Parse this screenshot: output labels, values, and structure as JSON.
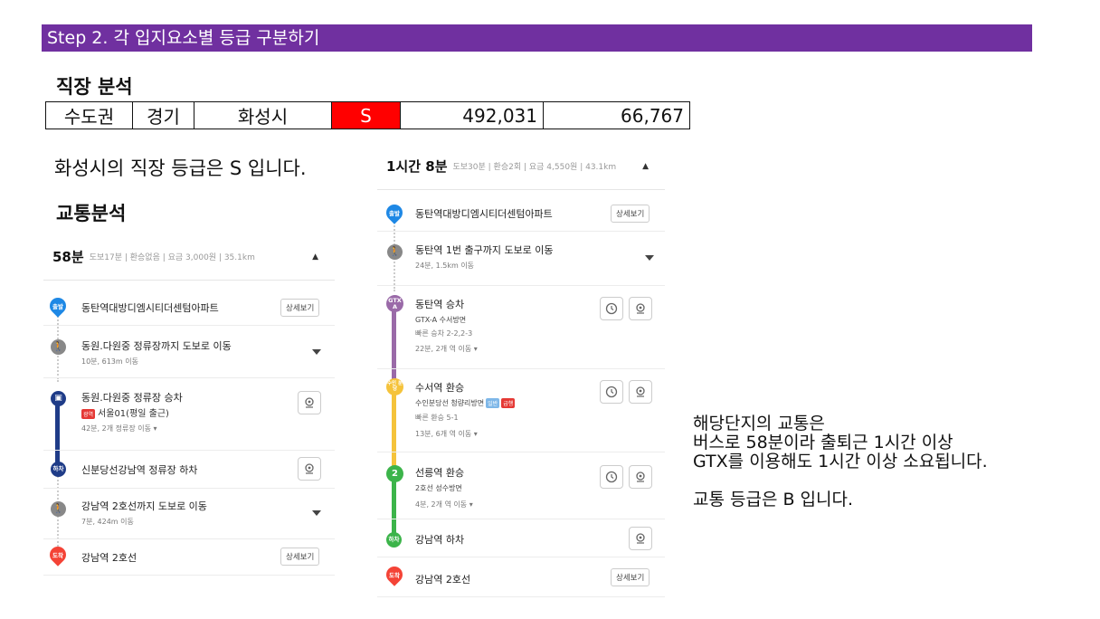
{
  "banner": "Step 2. 각 입지요소별 등급 구분하기",
  "job": {
    "title": "직장 분석",
    "cells": [
      "수도권",
      "경기",
      "화성시",
      "S",
      "492,031",
      "66,767"
    ],
    "grade_color": "#ff0000",
    "note": "화성시의 직장 등급은 S 입니다."
  },
  "transport": {
    "title": "교통분석",
    "left_route": {
      "duration": "58분",
      "meta": "도보17분 | 환승없음 | 요금 3,000원 | 35.1km",
      "steps": [
        {
          "title": "동탄역대방디엠시티더센텀아파트",
          "badge": "출발",
          "button": "상세보기"
        },
        {
          "title": "동원.다원중 정류장까지 도보로 이동",
          "sub": "10분, 613m 이동"
        },
        {
          "title": "동원.다원중 정류장 승차",
          "route": "서울01(평일 출근)",
          "route_tag": "광역",
          "info": "42분, 2개 정류장 이동 ▾"
        },
        {
          "title": "신분당선강남역 정류장 하차",
          "badge": "하차"
        },
        {
          "title": "강남역 2호선까지 도보로 이동",
          "sub": "7분, 424m 이동"
        },
        {
          "title": "강남역 2호선",
          "badge": "도착",
          "button": "상세보기"
        }
      ]
    },
    "right_route": {
      "duration": "1시간 8분",
      "meta": "도보30분 | 환승2회 | 요금 4,550원 | 43.1km",
      "steps": [
        {
          "title": "동탄역대방디엠시티더센텀아파트",
          "badge": "출발",
          "button": "상세보기"
        },
        {
          "title": "동탄역 1번 출구까지 도보로 이동",
          "sub": "24분, 1.5km 이동"
        },
        {
          "title": "동탄역 승차",
          "badge": "GTX A",
          "line": "GTX-A 수서방면",
          "fast": "빠른 승차 2-2,2-3",
          "info": "22분, 2개 역 이동 ▾"
        },
        {
          "title": "수서역 환승",
          "badge": "수인 분당",
          "line": "수인분당선 청량리방면",
          "tag1": "일반",
          "tag2": "급행",
          "fast": "빠른 환승 5-1",
          "info": "13분, 6개 역 이동 ▾"
        },
        {
          "title": "선릉역 환승",
          "badge": "2",
          "line": "2호선 성수방면",
          "info": "4분, 2개 역 이동 ▾"
        },
        {
          "title": "강남역 하차",
          "badge": "하차"
        },
        {
          "title": "강남역 2호선",
          "badge": "도착",
          "button": "상세보기"
        }
      ]
    },
    "summary": {
      "line1": "해당단지의 교통은",
      "line2": "버스로 58분이라 출퇴근 1시간 이상",
      "line3": "GTX를 이용해도 1시간 이상 소요됩니다.",
      "line4": "교통 등급은 B 입니다."
    }
  },
  "colors": {
    "banner": "#7030a0",
    "bus": "#1f3c88",
    "gtx": "#9a6aa8",
    "suin": "#f5c33b",
    "line2": "#3cb44a",
    "start": "#1e88e5",
    "end": "#f44336"
  }
}
